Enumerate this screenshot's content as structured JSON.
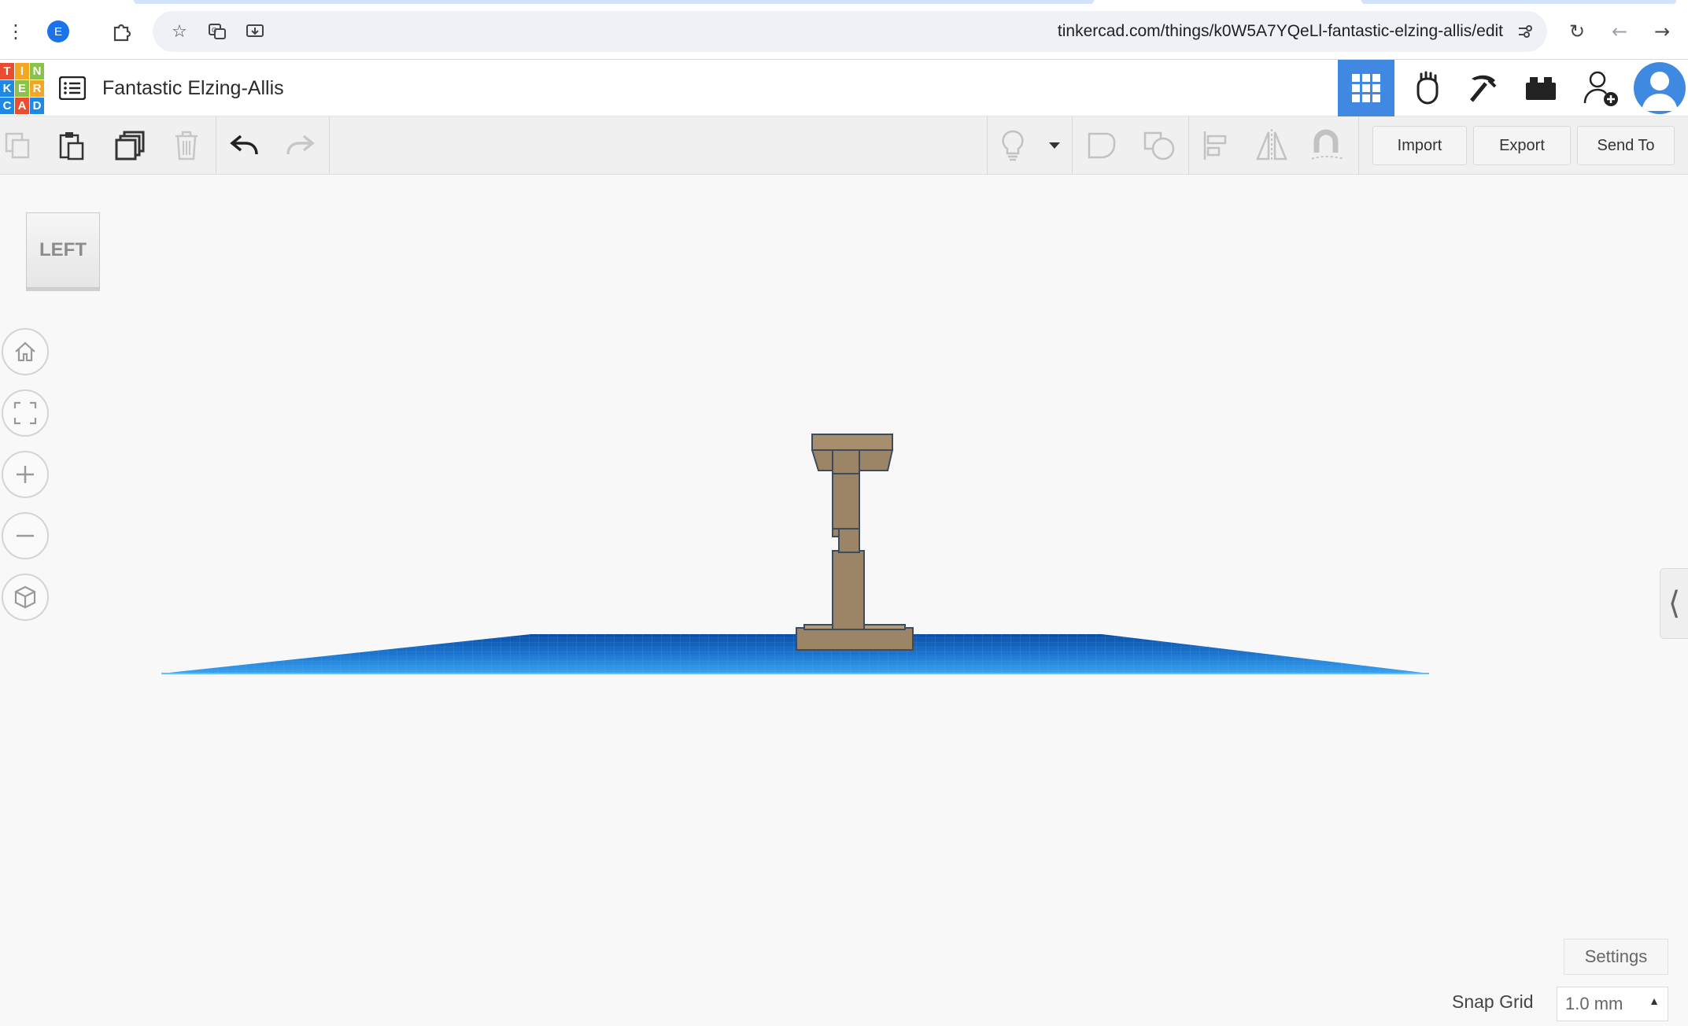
{
  "browser": {
    "profile_initial": "E",
    "url": "tinkercad.com/things/k0W5A7YQeLl-fantastic-elzing-allis/edit"
  },
  "app": {
    "logo_letters": [
      "T",
      "I",
      "N",
      "K",
      "E",
      "R",
      "C",
      "A",
      "D"
    ],
    "logo_colors": [
      "#e94c2f",
      "#f5a623",
      "#8bc34a",
      "#1e88e5",
      "#8bc34a",
      "#f5a623",
      "#1e88e5",
      "#e94c2f",
      "#1e88e5"
    ],
    "project_title": "Fantastic Elzing-Allis",
    "accent_color": "#3f8ae0"
  },
  "header_icons": [
    "3d-design-grid-icon",
    "circuits-hand-icon",
    "minecraft-pickaxe-icon",
    "lego-brick-icon",
    "invite-user-icon",
    "profile-avatar-icon"
  ],
  "toolbar": {
    "import_label": "Import",
    "export_label": "Export",
    "send_to_label": "Send To"
  },
  "viewcube": {
    "face_label": "LEFT"
  },
  "workplane": {
    "grid_color": "#1e7fd6",
    "model_color": "#9c8466"
  },
  "footer": {
    "settings_label": "Settings",
    "snap_grid_label": "Snap Grid",
    "snap_grid_value": "1.0 mm"
  }
}
